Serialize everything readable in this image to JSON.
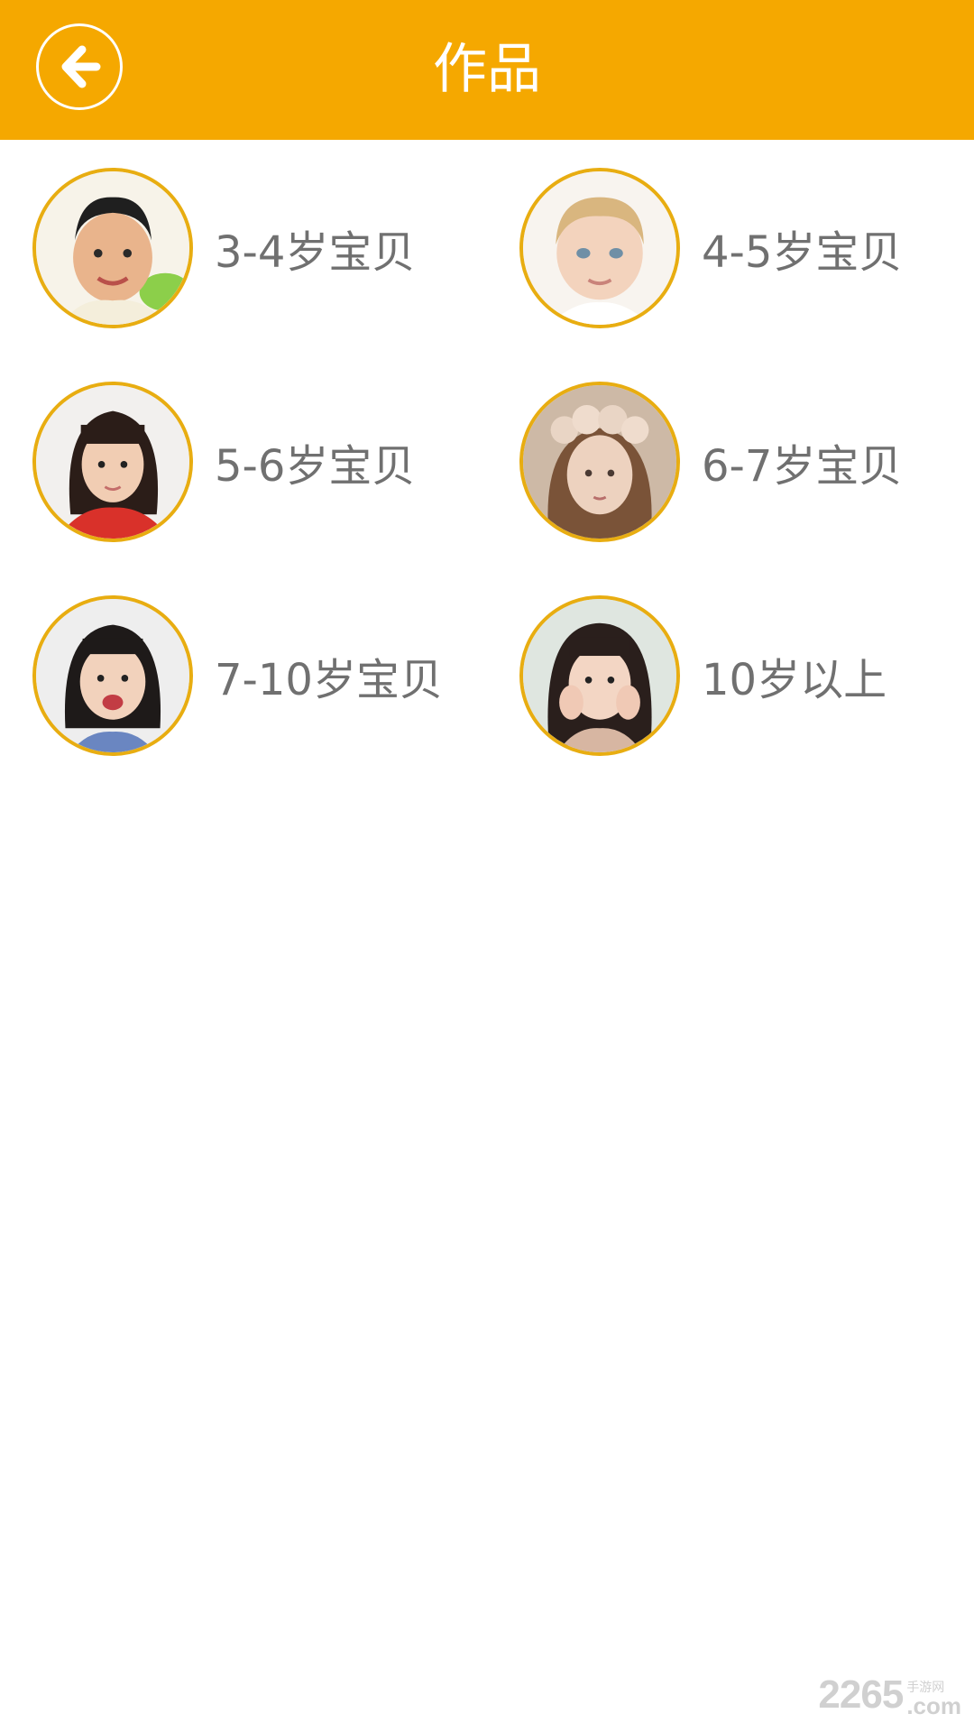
{
  "header": {
    "title": "作品",
    "back_icon": "arrow-left-icon",
    "background_color": "#f5a800"
  },
  "grid": {
    "items": [
      {
        "label": "3-4岁宝贝",
        "avatar": "boy-portrait"
      },
      {
        "label": "4-5岁宝贝",
        "avatar": "toddler-portrait"
      },
      {
        "label": "5-6岁宝贝",
        "avatar": "girl-portrait"
      },
      {
        "label": "6-7岁宝贝",
        "avatar": "girl-flower-crown-portrait"
      },
      {
        "label": "7-10岁宝贝",
        "avatar": "girl-smiling-portrait"
      },
      {
        "label": "10岁以上",
        "avatar": "girl-hands-face-portrait"
      }
    ],
    "avatar_border_color": "#e8ad11"
  },
  "watermark": {
    "number": "2265",
    "cn": "手游网",
    "com": ".com"
  }
}
